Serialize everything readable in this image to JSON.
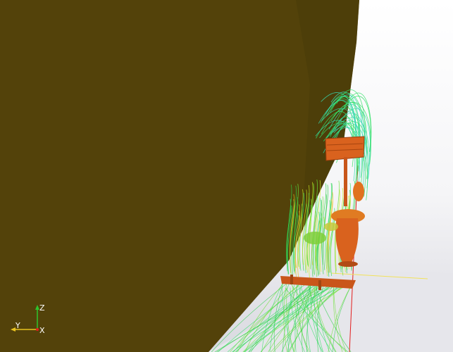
{
  "scene": {
    "background_top": "#ffffff",
    "background_bottom": "#d9d9e0",
    "wall_color": "#53420a",
    "furniture_color": "#d9621e",
    "streamline_colors": [
      "#35e06a",
      "#2fd04a",
      "#6de23a",
      "#c9e81f",
      "#e8c21f",
      "#36d9b0"
    ]
  },
  "axes": {
    "z_label": "Z",
    "y_label": "Y",
    "x_label": "X",
    "z_color": "#2ec52e",
    "y_color": "#e8c21f",
    "x_color": "#e21e1e"
  }
}
